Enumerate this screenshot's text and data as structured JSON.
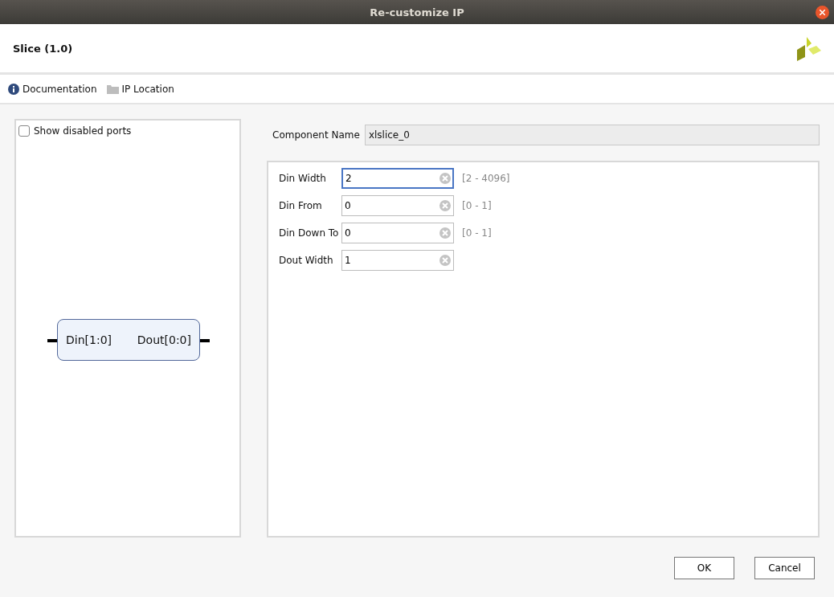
{
  "window": {
    "title": "Re-customize IP"
  },
  "header": {
    "title": "Slice (1.0)"
  },
  "toolbar": [
    {
      "kind": "info",
      "label": "Documentation"
    },
    {
      "kind": "folder",
      "label": "IP Location"
    }
  ],
  "preview": {
    "show_disabled_ports": {
      "label": "Show disabled ports",
      "checked": false
    },
    "block": {
      "input_port": "Din[1:0]",
      "output_port": "Dout[0:0]"
    }
  },
  "component_name": {
    "label": "Component Name",
    "value": "xlslice_0"
  },
  "params": [
    {
      "label": "Din Width",
      "value": "2",
      "range": "[2 - 4096]",
      "focused": true
    },
    {
      "label": "Din From",
      "value": "0",
      "range": "[0 - 1]",
      "focused": false
    },
    {
      "label": "Din Down To",
      "value": "0",
      "range": "[0 - 1]",
      "focused": false
    },
    {
      "label": "Dout Width",
      "value": "1",
      "focused": false
    }
  ],
  "buttons": [
    "OK",
    "Cancel"
  ]
}
